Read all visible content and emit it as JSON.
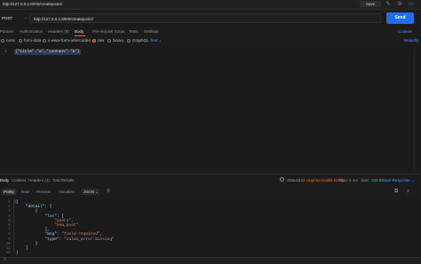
{
  "window": {
    "title": "http://127.0.0.1:8000/createposts/"
  },
  "toolbar": {
    "save_label": "Save"
  },
  "request": {
    "method": "POST",
    "url": "http://127.0.0.1:8000/createposts/",
    "send_label": "Send",
    "tabs": [
      "Params",
      "Authorization",
      "Headers (8)",
      "Body",
      "Pre-request Script",
      "Tests",
      "Settings"
    ],
    "active_tab": "Body",
    "cookies_label": "Cookies",
    "body_options": [
      "none",
      "form-data",
      "x-www-form-urlencoded",
      "raw",
      "binary",
      "GraphQL"
    ],
    "selected_option": "raw",
    "text_type": "Text",
    "beautify_label": "Beautify",
    "editor_line": "1",
    "editor_content": "{\"title\":\"a\",\"content\":\"b\"}"
  },
  "response": {
    "tabs": [
      "Body",
      "Cookies",
      "Headers (4)",
      "Test Results"
    ],
    "active_tab": "Body",
    "status_label": "Status:",
    "status_value": "422 Unprocessable Entity",
    "time_label": "Time:",
    "time_value": "8 ms",
    "size_label": "Size:",
    "size_value": "236 B",
    "save_response_label": "Save Response",
    "formats": [
      "Pretty",
      "Raw",
      "Preview",
      "Visualize"
    ],
    "active_format": "Pretty",
    "format_type": "JSON",
    "lines": [
      {
        "n": "1",
        "text": "{"
      },
      {
        "n": "2",
        "text": "    \"detail\": ["
      },
      {
        "n": "3",
        "text": "        {"
      },
      {
        "n": "4",
        "text": "            \"loc\": ["
      },
      {
        "n": "5",
        "text": "                \"query\","
      },
      {
        "n": "6",
        "text": "                \"new_post\""
      },
      {
        "n": "7",
        "text": "            ],"
      },
      {
        "n": "8",
        "text": "            \"msg\": \"field required\","
      },
      {
        "n": "9",
        "text": "            \"type\": \"value_error.missing\""
      },
      {
        "n": "10",
        "text": "        }"
      },
      {
        "n": "11",
        "text": "    ]"
      },
      {
        "n": "12",
        "text": "}"
      }
    ]
  },
  "icons": [
    "help-icon",
    "edit-icon",
    "comment-icon",
    "globe-icon",
    "copy-icon",
    "search-icon",
    "wrap-icon"
  ],
  "colors": {
    "accent": "#ff6c37",
    "send": "#1f6feb",
    "link": "#4a9eff",
    "ok": "#4ec27a"
  }
}
